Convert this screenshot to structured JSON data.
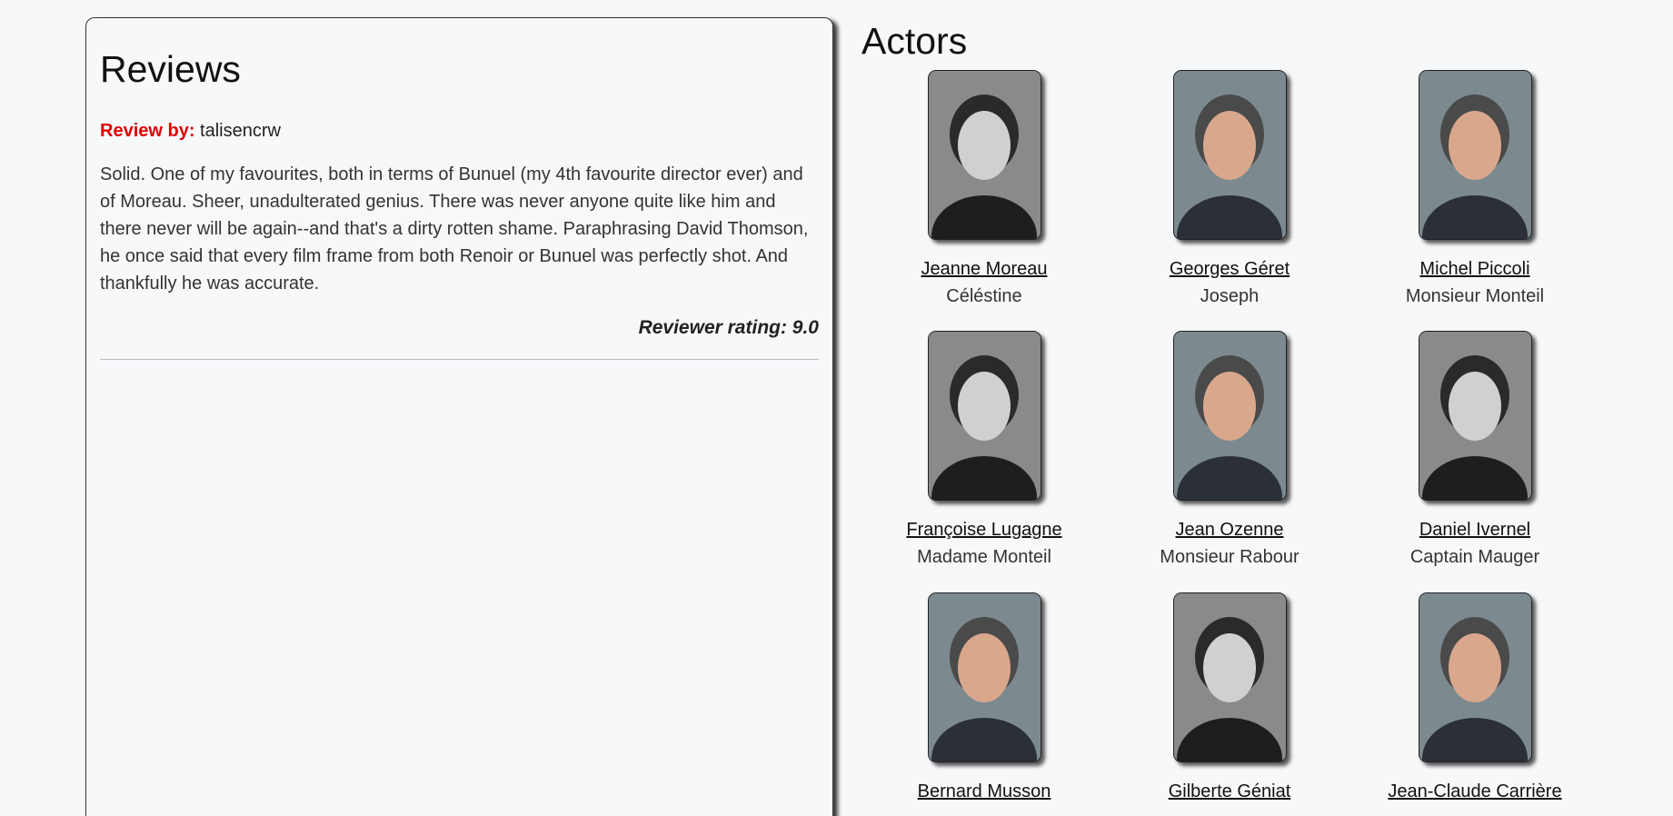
{
  "reviews": {
    "title": "Reviews",
    "items": [
      {
        "by_label": "Review by:",
        "author": "talisencrw",
        "text": "Solid. One of my favourites, both in terms of Bunuel (my 4th favourite director ever) and of Moreau. Sheer, unadulterated genius. There was never anyone quite like him and there never will be again--and that's a dirty rotten shame. Paraphrasing David Thomson, he once said that every film frame from both Renoir or Bunuel was perfectly shot. And thankfully he was accurate.",
        "rating": "Reviewer rating: 9.0"
      }
    ]
  },
  "actors": {
    "title": "Actors",
    "items": [
      {
        "name": "Jeanne Moreau",
        "role": "Céléstine",
        "photo": "portrait-bw"
      },
      {
        "name": "Georges Géret",
        "role": "Joseph",
        "photo": "portrait-color"
      },
      {
        "name": "Michel Piccoli",
        "role": "Monsieur Monteil",
        "photo": "portrait-color"
      },
      {
        "name": "Françoise Lugagne",
        "role": "Madame Monteil",
        "photo": "portrait-bw"
      },
      {
        "name": "Jean Ozenne",
        "role": "Monsieur Rabour",
        "photo": "portrait-color"
      },
      {
        "name": "Daniel Ivernel",
        "role": "Captain Mauger",
        "photo": "portrait-bw"
      },
      {
        "name": "Bernard Musson",
        "role": "",
        "photo": "portrait-color"
      },
      {
        "name": "Gilberte Géniat",
        "role": "",
        "photo": "portrait-bw"
      },
      {
        "name": "Jean-Claude Carrière",
        "role": "",
        "photo": "portrait-color"
      }
    ]
  },
  "colors": {
    "background": "#f7f8fa",
    "review_label": "#e00000"
  }
}
